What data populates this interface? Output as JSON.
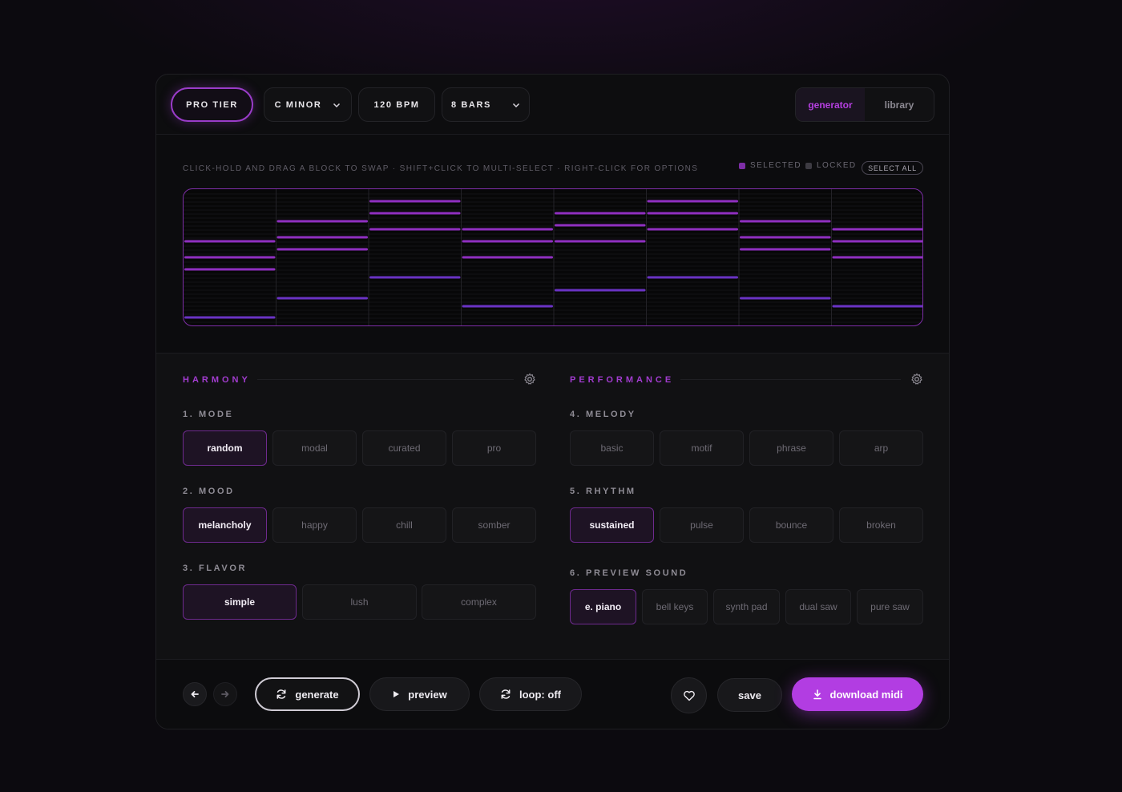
{
  "topbar": {
    "tier": "PRO TIER",
    "key": "C MINOR",
    "bpm": "120 BPM",
    "bars": "8 BARS",
    "tabs": [
      {
        "label": "generator",
        "active": true
      },
      {
        "label": "library",
        "active": false
      }
    ]
  },
  "roll": {
    "hint": "CLICK-HOLD AND DRAG A BLOCK TO SWAP · SHIFT+CLICK TO MULTI-SELECT · RIGHT-CLICK FOR OPTIONS",
    "legend_selected": "SELECTED",
    "legend_locked": "LOCKED",
    "select_all": "SELECT ALL",
    "bars": 8
  },
  "harmony": {
    "title": "HARMONY",
    "groups": [
      {
        "label": "1. MODE",
        "options": [
          "random",
          "modal",
          "curated",
          "pro"
        ],
        "selected": 0
      },
      {
        "label": "2. MOOD",
        "options": [
          "melancholy",
          "happy",
          "chill",
          "somber"
        ],
        "selected": 0
      },
      {
        "label": "3. FLAVOR",
        "options": [
          "simple",
          "lush",
          "complex"
        ],
        "selected": 0
      }
    ]
  },
  "performance": {
    "title": "PERFORMANCE",
    "groups": [
      {
        "label": "4. MELODY",
        "options": [
          "basic",
          "motif",
          "phrase",
          "arp"
        ],
        "selected": -1
      },
      {
        "label": "5. RHYTHM",
        "options": [
          "sustained",
          "pulse",
          "bounce",
          "broken"
        ],
        "selected": 0
      },
      {
        "label": "6. PREVIEW SOUND",
        "options": [
          "e. piano",
          "bell keys",
          "synth pad",
          "dual saw",
          "pure saw"
        ],
        "selected": 0
      }
    ]
  },
  "actions": {
    "generate": "generate",
    "preview": "preview",
    "loop": "loop: off",
    "save": "save",
    "download": "download midi"
  },
  "colors": {
    "accent": "#b23de2",
    "note": "#8f2fc0",
    "bass": "#6a33c4"
  }
}
